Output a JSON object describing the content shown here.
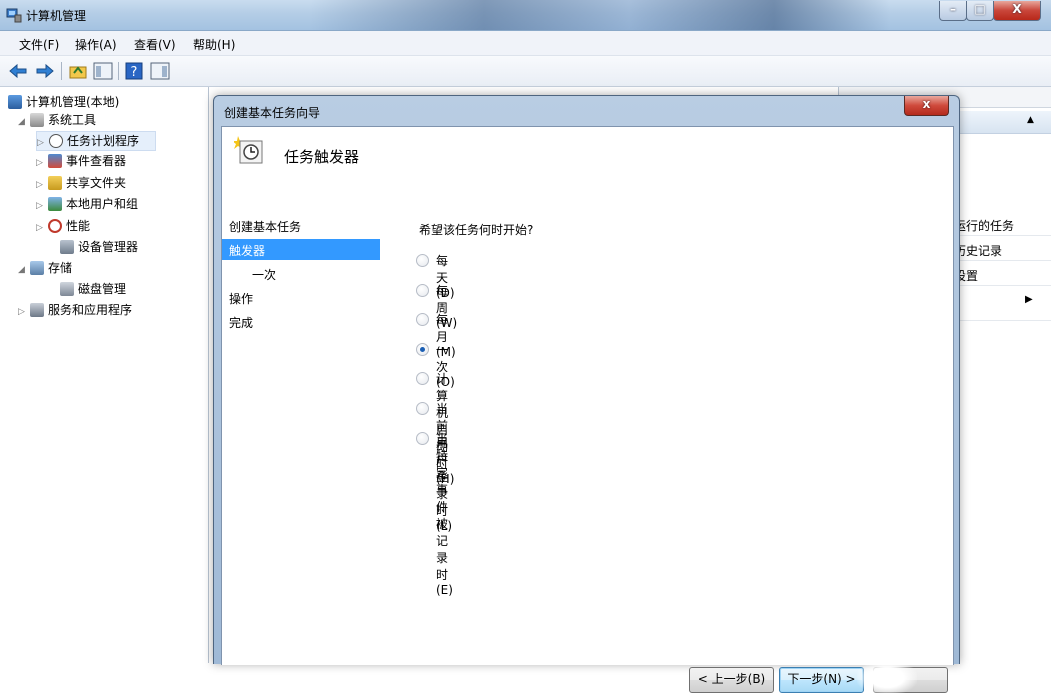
{
  "window": {
    "title": "计算机管理"
  },
  "menu": [
    "文件(F)",
    "操作(A)",
    "查看(V)",
    "帮助(H)"
  ],
  "tree": {
    "root": "计算机管理(本地)",
    "system_tools": "系统工具",
    "task_scheduler": "任务计划程序",
    "event_viewer": "事件查看器",
    "shared_folders": "共享文件夹",
    "local_users": "本地用户和组",
    "performance": "性能",
    "device_manager": "设备管理器",
    "storage": "存储",
    "disk_management": "磁盘管理",
    "services_apps": "服务和应用程序"
  },
  "actions": {
    "items": [
      "运行的任务",
      "历史记录",
      "设置"
    ]
  },
  "dialog": {
    "title": "创建基本任务向导",
    "heading": "任务触发器",
    "steps": [
      "创建基本任务",
      "触发器",
      "一次",
      "操作",
      "完成"
    ],
    "question": "希望该任务何时开始?",
    "options": [
      "每天(D)",
      "每周(W)",
      "每月(M)",
      "一次(O)",
      "计算机启动时(H)",
      "当前用户登录时(L)",
      "当特定事件被记录时(E)"
    ],
    "selected_option": "一次(O)",
    "buttons": {
      "back": "< 上一步(B)",
      "next": "下一步(N) >"
    }
  },
  "colors": {
    "selection": "#3399ff",
    "title_gradient": "#b4cde6"
  }
}
